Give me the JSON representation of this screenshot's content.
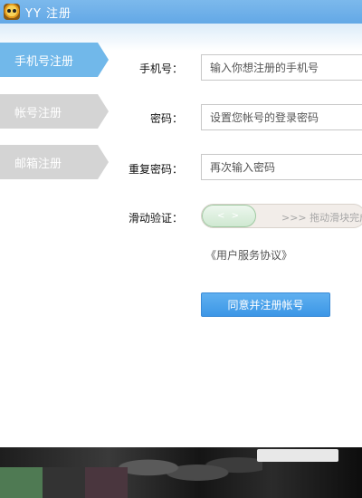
{
  "window": {
    "title": "YY 注册",
    "icon": "yy-raccoon-logo"
  },
  "tabs": [
    {
      "label": "手机号注册",
      "active": true
    },
    {
      "label": "帐号注册",
      "active": false
    },
    {
      "label": "邮箱注册",
      "active": false
    }
  ],
  "form": {
    "phone": {
      "label": "手机号：",
      "placeholder": "输入你想注册的手机号",
      "value": ""
    },
    "password": {
      "label": "密码：",
      "placeholder": "设置您帐号的登录密码",
      "value": ""
    },
    "confirm": {
      "label": "重复密码：",
      "placeholder": "再次输入密码",
      "value": ""
    },
    "slider": {
      "label": "滑动验证：",
      "knob_glyph": "<  >",
      "hint": ">>>  拖动滑块完成验证",
      "progress": 0
    }
  },
  "agreement_link": "《用户服务协议》",
  "submit_label": "同意并注册帐号",
  "colors": {
    "titlebar": "#6aaee8",
    "active_tab": "#71b8ea",
    "inactive_tab": "#d4d4d4",
    "button": "#4aa2ea",
    "slider_knob": "#cfe8d1"
  },
  "footer": {
    "swatches": [
      "#4f7a53",
      "#333333",
      "#4a363e"
    ]
  }
}
